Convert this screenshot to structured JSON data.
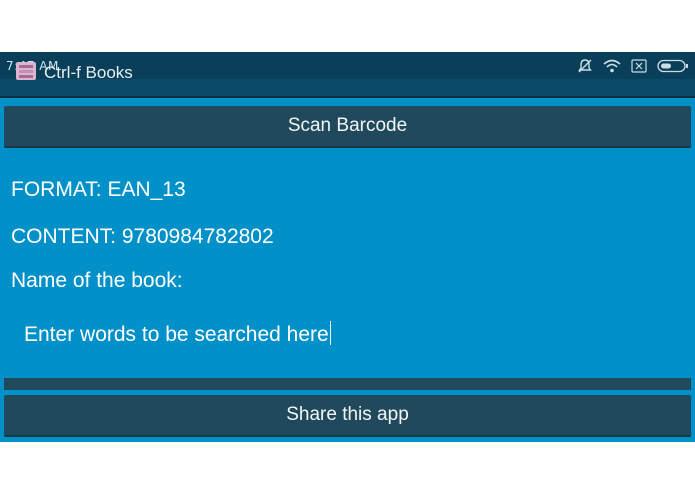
{
  "status_bar": {
    "time": "7:47 AM",
    "icons": [
      "notification-muted-icon",
      "wifi-icon",
      "no-sim-icon",
      "battery-icon"
    ]
  },
  "app_bar": {
    "title": "Ctrl-f Books",
    "icon": "app-book-icon"
  },
  "main": {
    "scan_button_label": "Scan Barcode",
    "format_label": "FORMAT: EAN_13",
    "content_label": "CONTENT: 9780984782802",
    "book_name_label": "Name of the book:",
    "search_input": {
      "value": "Enter words to be searched here",
      "placeholder": ""
    },
    "share_button_label": "Share this app"
  },
  "colors": {
    "background": "#0290c9",
    "app_bar": "#0b4a68",
    "button": "#204a5c",
    "text": "#ffffff"
  }
}
